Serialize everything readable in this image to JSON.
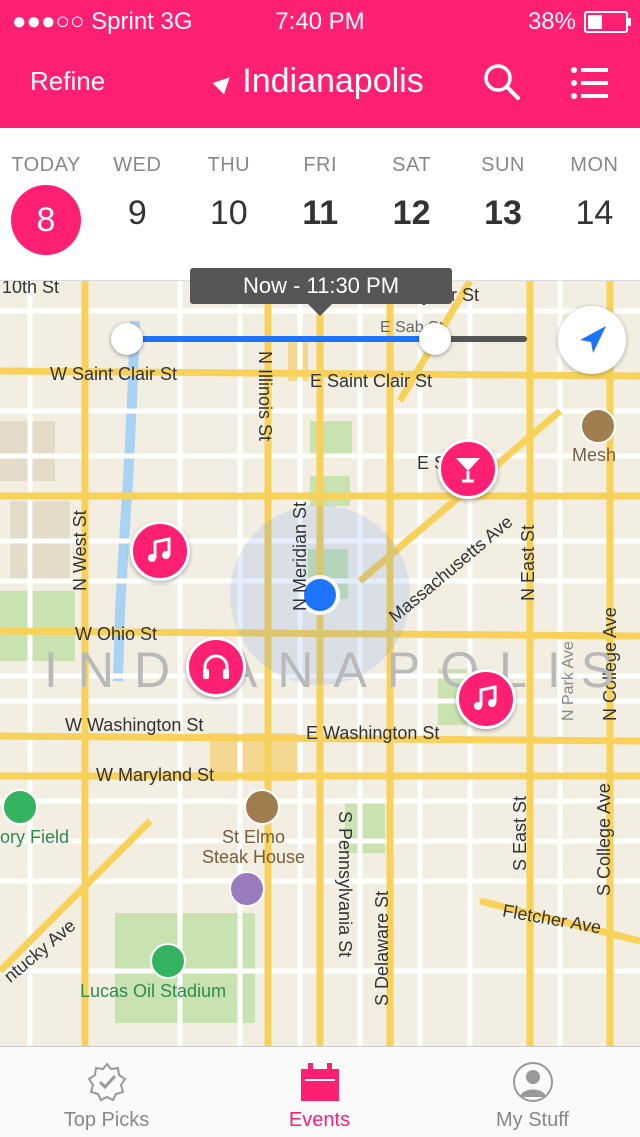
{
  "status_bar": {
    "carrier": "●●●○○ Sprint  3G",
    "time": "7:40 PM",
    "battery": "38%",
    "battery_level": 0.38
  },
  "header": {
    "refine_label": "Refine",
    "city": "Indianapolis"
  },
  "days": [
    {
      "dow": "TODAY",
      "num": "8",
      "selected": true
    },
    {
      "dow": "WED",
      "num": "9"
    },
    {
      "dow": "THU",
      "num": "10"
    },
    {
      "dow": "FRI",
      "num": "11",
      "bold": true
    },
    {
      "dow": "SAT",
      "num": "12",
      "bold": true
    },
    {
      "dow": "SUN",
      "num": "13",
      "bold": true
    },
    {
      "dow": "MON",
      "num": "14"
    }
  ],
  "time_slider": {
    "label": "Now - 11:30 PM",
    "start_fraction": 0.0,
    "end_fraction": 0.77
  },
  "map_labels": {
    "city_watermark": "INDIANAPOLIS",
    "tenth_st": "10th St",
    "fayette": "Furyear St",
    "e_saint": "E Sab   St",
    "w_saint_clair": "W Saint Clair St",
    "e_saint_clair": "E Saint Clair St",
    "n_illinois": "N Illinois St",
    "n_meridian": "N Meridian St",
    "massachusetts": "Massachusetts Ave",
    "n_west": "N West St",
    "w_ohio": "W Ohio St",
    "n_east": "N East St",
    "n_park": "N Park Ave",
    "n_college": "N College Ave",
    "w_washington": "W Washington St",
    "e_washington": "E Washington St",
    "w_maryland": "W Maryland St",
    "s_pennsylvania": "S Pennsylvania St",
    "s_delaware": "S Delaware St",
    "s_east": "S East St",
    "s_college": "S College Ave",
    "fletcher": "Fletcher Ave",
    "kentucky": "ntucky Ave",
    "victory_field": "ory Field",
    "st_elmo": "St Elmo\nSteak House",
    "lucas_oil": "Lucas Oil Stadium",
    "mesh": "Mesh",
    "e_st": "E         St"
  },
  "tabs": [
    {
      "label": "Top Picks",
      "icon": "badge-check-icon"
    },
    {
      "label": "Events",
      "icon": "calendar-icon",
      "active": true
    },
    {
      "label": "My Stuff",
      "icon": "person-icon"
    }
  ],
  "colors": {
    "accent": "#ff1f73",
    "map_background": "#f3eee2",
    "location_blue": "#1e74ff"
  }
}
